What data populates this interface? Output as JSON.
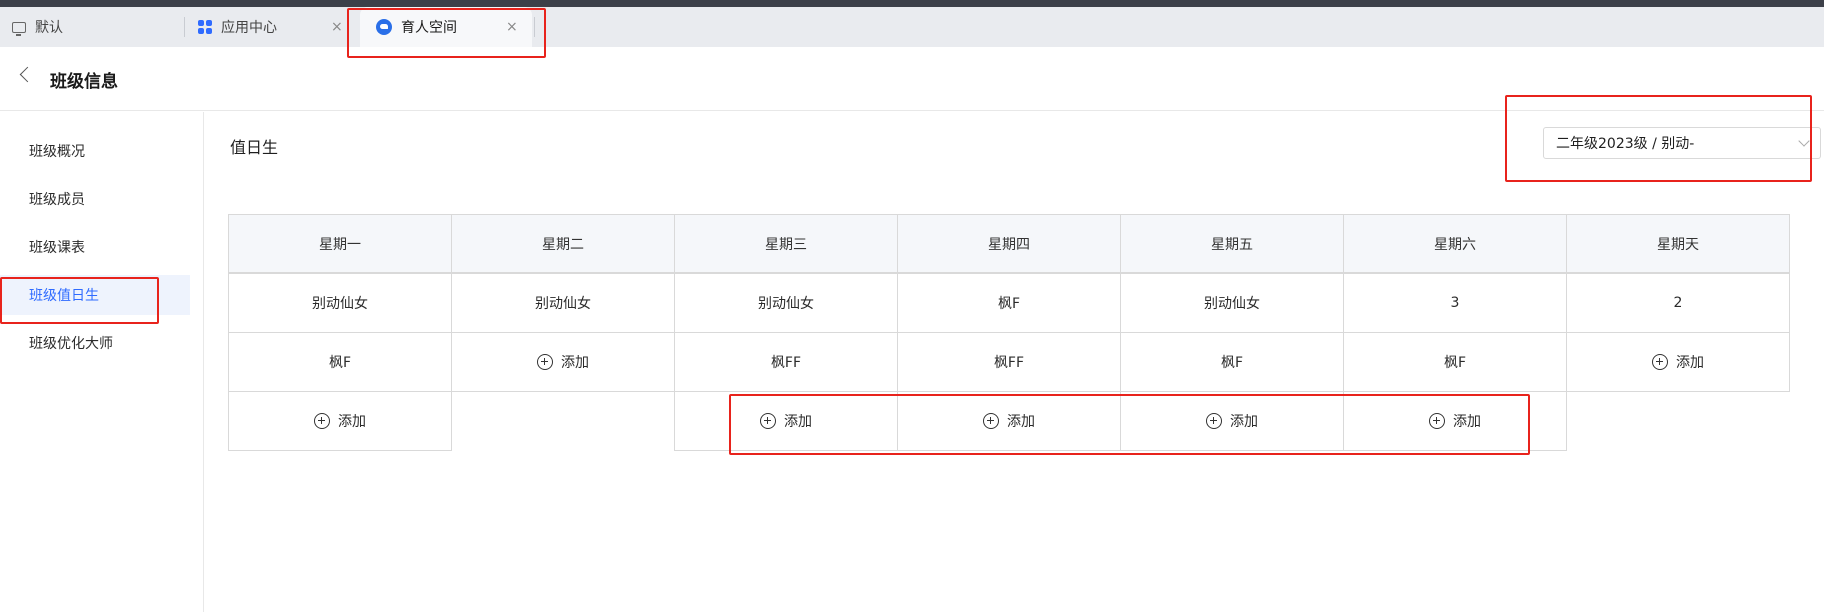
{
  "tabs": [
    {
      "label": "默认",
      "icon": "monitor-icon"
    },
    {
      "label": "应用中心",
      "icon": "grid-apps-icon",
      "close": "×"
    },
    {
      "label": "育人空间",
      "icon": "app-logo-icon",
      "close": "×"
    }
  ],
  "header": {
    "title": "班级信息"
  },
  "sidebar": {
    "items": [
      {
        "label": "班级概况"
      },
      {
        "label": "班级成员"
      },
      {
        "label": "班级课表"
      },
      {
        "label": "班级值日生",
        "active": true
      },
      {
        "label": "班级优化大师"
      }
    ]
  },
  "main": {
    "section_title": "值日生",
    "class_select": {
      "value": "二年级2023级 / 别动-"
    },
    "add_label": "添加",
    "days": [
      "星期一",
      "星期二",
      "星期三",
      "星期四",
      "星期五",
      "星期六",
      "星期天"
    ],
    "rows": [
      [
        "别动仙女",
        "别动仙女",
        "别动仙女",
        "枫F",
        "别动仙女",
        "3",
        "2"
      ],
      [
        "枫F",
        "添加",
        "枫FF",
        "枫FF",
        "枫F",
        "枫F",
        "添加"
      ],
      [
        "添加",
        "",
        "添加",
        "添加",
        "添加",
        "添加",
        ""
      ]
    ]
  },
  "colors": {
    "accent": "#2f6bff",
    "highlight": "#e8231c",
    "header_bg": "#f5f7fa"
  }
}
